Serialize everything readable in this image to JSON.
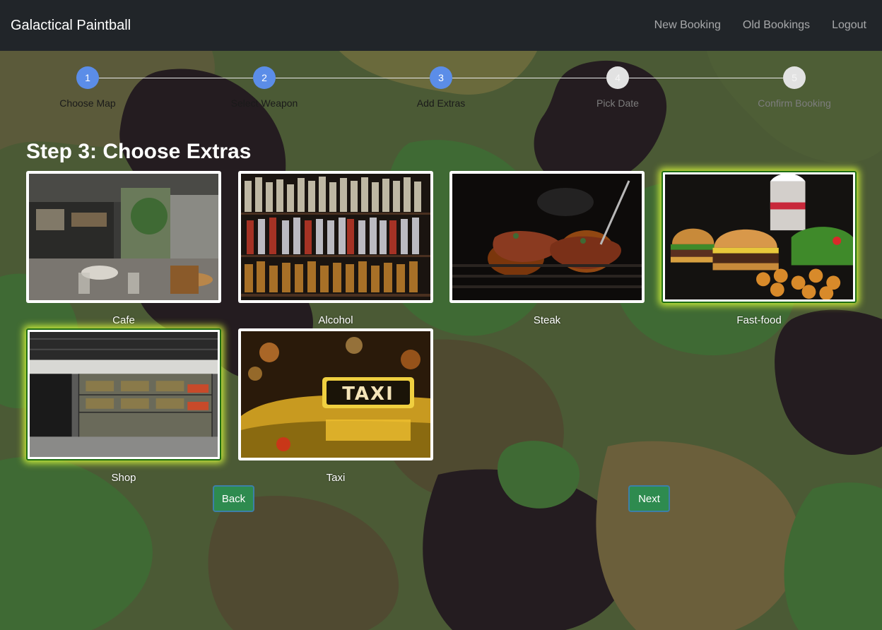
{
  "navbar": {
    "brand": "Galactical Paintball",
    "links": [
      "New Booking",
      "Old Bookings",
      "Logout"
    ]
  },
  "stepper": {
    "steps": [
      {
        "number": "1",
        "label": "Choose Map",
        "state": "active"
      },
      {
        "number": "2",
        "label": "Select Weapon",
        "state": "active"
      },
      {
        "number": "3",
        "label": "Add Extras",
        "state": "active"
      },
      {
        "number": "4",
        "label": "Pick Date",
        "state": "inactive"
      },
      {
        "number": "5",
        "label": "Confirm Booking",
        "state": "inactive"
      }
    ]
  },
  "page": {
    "title": "Step 3: Choose Extras"
  },
  "extras": [
    {
      "label": "Cafe",
      "selected": false,
      "image": "cafe-interior"
    },
    {
      "label": "Alcohol",
      "selected": false,
      "image": "liquor-shelves"
    },
    {
      "label": "Steak",
      "selected": false,
      "image": "grilled-steak"
    },
    {
      "label": "Fast-food",
      "selected": true,
      "image": "burgers-and-fries"
    },
    {
      "label": "Shop",
      "selected": true,
      "image": "paintball-shop"
    },
    {
      "label": "Taxi",
      "selected": false,
      "image": "taxi-sign"
    }
  ],
  "buttons": {
    "back": "Back",
    "next": "Next"
  },
  "colors": {
    "navbar": "#212529",
    "step_active": "#5b8de8",
    "step_inactive": "#e2e2e2",
    "button": "#2e8b4f",
    "selected_glow": "#dcff3c"
  }
}
